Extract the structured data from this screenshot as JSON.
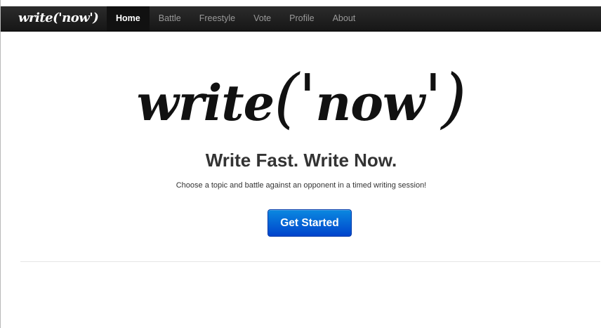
{
  "navbar": {
    "brand": "write('now')",
    "items": [
      {
        "label": "Home",
        "active": true
      },
      {
        "label": "Battle",
        "active": false
      },
      {
        "label": "Freestyle",
        "active": false
      },
      {
        "label": "Vote",
        "active": false
      },
      {
        "label": "Profile",
        "active": false
      },
      {
        "label": "About",
        "active": false
      }
    ]
  },
  "hero": {
    "logo_word1": "write",
    "logo_open": "('",
    "logo_word2": "now",
    "logo_close": "')",
    "headline": "Write Fast. Write Now.",
    "tagline": "Choose a topic and battle against an opponent in a timed writing session!",
    "cta_label": "Get Started"
  },
  "colors": {
    "navbar_bg": "#1b1b1b",
    "nav_active_text": "#ffffff",
    "nav_text": "#999999",
    "cta_blue": "#0066cc",
    "headline_text": "#333333"
  }
}
